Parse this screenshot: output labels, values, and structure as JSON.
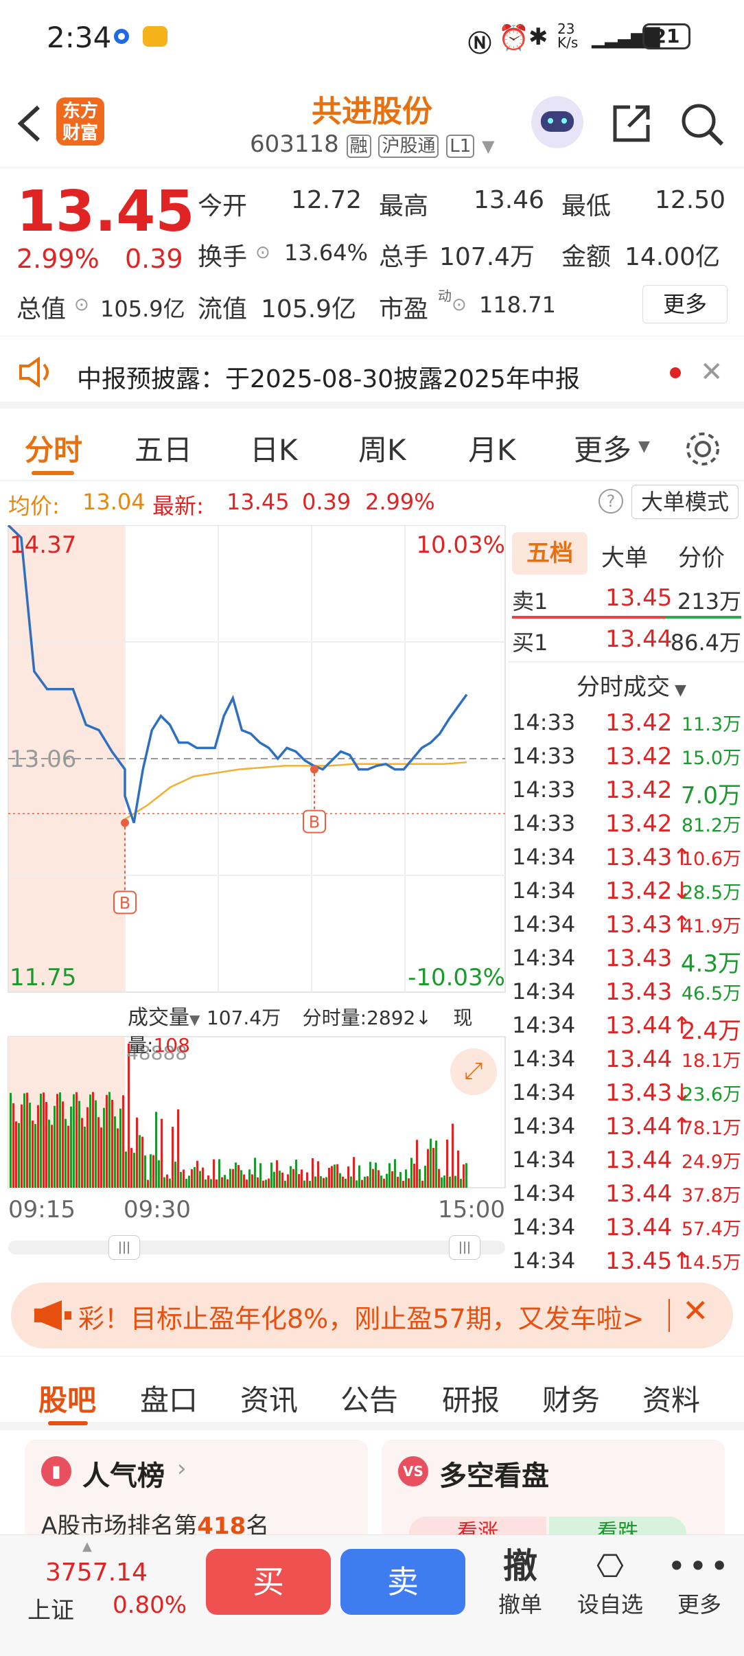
{
  "status": {
    "time": "2:34",
    "net": "23\nK/s",
    "battery": "21"
  },
  "header": {
    "logo_line1": "东方",
    "logo_line2": "财富",
    "name": "共进股份",
    "code": "603118",
    "tags": [
      "融",
      "沪股通",
      "L1"
    ]
  },
  "quote": {
    "price": "13.45",
    "pct": "2.99%",
    "chg": "0.39",
    "open_l": "今开",
    "open": "12.72",
    "high_l": "最高",
    "high": "13.46",
    "low_l": "最低",
    "low": "12.50",
    "turnover_l": "换手",
    "turnover": "13.64%",
    "vol_l": "总手",
    "vol": "107.4万",
    "amt_l": "金额",
    "amt": "14.00亿",
    "mcap_l": "总值",
    "mcap": "105.9亿",
    "float_l": "流值",
    "float": "105.9亿",
    "pe_l": "市盈",
    "pe_sup": "动",
    "pe": "118.71",
    "more": "更多"
  },
  "notice": {
    "text": "中报预披露：于2025-08-30披露2025年中报"
  },
  "ktabs": [
    "分时",
    "五日",
    "日K",
    "周K",
    "月K",
    "更多"
  ],
  "avgbar": {
    "avg_l": "均价:",
    "avg": "13.04",
    "last_l": "最新:",
    "last": "13.45",
    "chg": "0.39",
    "pct": "2.99%",
    "mode": "大单模式"
  },
  "chart_data": {
    "type": "line",
    "title": "",
    "y_max": 14.37,
    "y_min": 11.75,
    "y_ref": 13.06,
    "pct_max": "10.03%",
    "pct_min": "-10.03%",
    "price_series": [
      14.37,
      14.3,
      13.55,
      13.45,
      13.45,
      13.45,
      13.25,
      13.22,
      13.1,
      13.0,
      12.85,
      12.7,
      13.0,
      13.22,
      13.3,
      13.25,
      13.15,
      13.15,
      13.12,
      13.12,
      13.12,
      13.3,
      13.4,
      13.22,
      13.2,
      13.15,
      13.12,
      13.06,
      13.12,
      13.1,
      13.05,
      13.02,
      13.0,
      13.05,
      13.1,
      13.08,
      13.0,
      13.0,
      13.02,
      13.03,
      13.0,
      13.0,
      13.06,
      13.12,
      13.15,
      13.2,
      13.28,
      13.35,
      13.42
    ],
    "avg_series": [
      12.72,
      12.8,
      12.9,
      12.96,
      12.98,
      13.0,
      13.01,
      13.02,
      13.02,
      13.02,
      13.03,
      13.03,
      13.03,
      13.03,
      13.03,
      13.04
    ],
    "markers": [
      "B",
      "B"
    ],
    "vol_label": "成交量",
    "vol_total": "107.4万",
    "minute_vol_l": "分时量:",
    "minute_vol": "2892",
    "now_l": "现量:",
    "now_vol": "108",
    "vol_max": "48888",
    "x_labels": [
      "09:15",
      "09:30",
      "15:00"
    ]
  },
  "side": {
    "tabs": [
      "五档",
      "大单",
      "分价"
    ],
    "sell1_l": "卖1",
    "sell1_p": "13.45",
    "sell1_v": "213万",
    "buy1_l": "买1",
    "buy1_p": "13.44",
    "buy1_v": "86.4万",
    "ticks_title": "分时成交",
    "ticks": [
      {
        "t": "14:33",
        "p": "13.42",
        "v": "11.3万",
        "c": "g"
      },
      {
        "t": "14:33",
        "p": "13.42",
        "v": "15.0万",
        "c": "g"
      },
      {
        "t": "14:33",
        "p": "13.42",
        "v": "7.0万",
        "c": "g"
      },
      {
        "t": "14:33",
        "p": "13.42",
        "v": "81.2万",
        "c": "g"
      },
      {
        "t": "14:34",
        "p": "13.43↑",
        "v": "10.6万",
        "c": "r"
      },
      {
        "t": "14:34",
        "p": "13.42↓",
        "v": "28.5万",
        "c": "g"
      },
      {
        "t": "14:34",
        "p": "13.43↑",
        "v": "41.9万",
        "c": "r"
      },
      {
        "t": "14:34",
        "p": "13.43",
        "v": "4.3万",
        "c": "g"
      },
      {
        "t": "14:34",
        "p": "13.43",
        "v": "46.5万",
        "c": "g"
      },
      {
        "t": "14:34",
        "p": "13.44↑",
        "v": "2.4万",
        "c": "r"
      },
      {
        "t": "14:34",
        "p": "13.44",
        "v": "18.1万",
        "c": "r"
      },
      {
        "t": "14:34",
        "p": "13.43↓",
        "v": "23.6万",
        "c": "g"
      },
      {
        "t": "14:34",
        "p": "13.44↑",
        "v": "78.1万",
        "c": "r"
      },
      {
        "t": "14:34",
        "p": "13.44",
        "v": "24.9万",
        "c": "r"
      },
      {
        "t": "14:34",
        "p": "13.44",
        "v": "37.8万",
        "c": "r"
      },
      {
        "t": "14:34",
        "p": "13.44",
        "v": "57.4万",
        "c": "r"
      },
      {
        "t": "14:34",
        "p": "13.45↑",
        "v": "14.5万",
        "c": "r"
      }
    ]
  },
  "promo": {
    "text": "彩！目标止盈年化8%，刚止盈57期，又发车啦>"
  },
  "btabs": [
    "股吧",
    "盘口",
    "资讯",
    "公告",
    "研报",
    "财务",
    "资料"
  ],
  "cards": {
    "c1_title": "人气榜",
    "c1_sub_pre": "A股市场排名第",
    "c1_rank": "418",
    "c1_sub_post": "名",
    "c2_title": "多空看盘",
    "c2_up": "看涨",
    "c2_down": "看跌"
  },
  "bottom": {
    "index": "3757.14",
    "index_name": "上证",
    "index_pct": "0.80%",
    "buy": "买",
    "sell": "卖",
    "cancel_icon": "撤",
    "cancel": "撤单",
    "watch": "设自选",
    "more": "更多"
  }
}
